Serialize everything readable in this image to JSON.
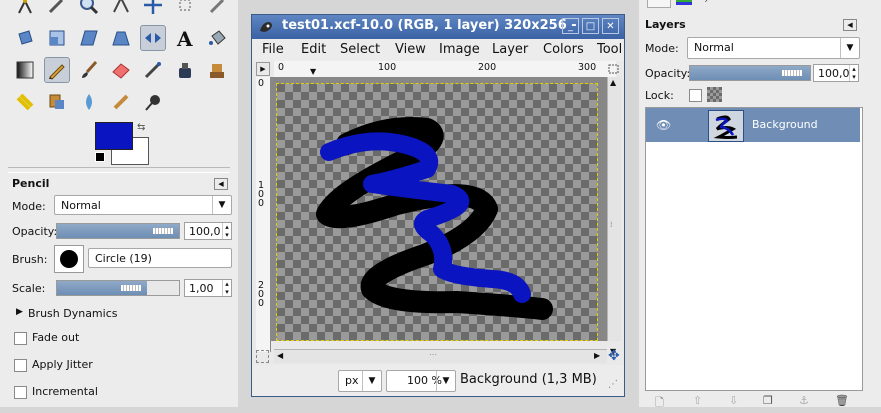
{
  "image_window": {
    "title": "test01.xcf-10.0 (RGB, 1 layer) 320x256 -",
    "menus": [
      "File",
      "Edit",
      "Select",
      "View",
      "Image",
      "Layer",
      "Colors",
      "Tool"
    ],
    "ruler_top_labels": [
      "0",
      "100",
      "200",
      "300"
    ],
    "ruler_left_labels": [
      "0",
      "1\n0\n0",
      "2\n0\n0"
    ],
    "status": {
      "unit": "px",
      "zoom": "100 %",
      "info": "Background (1,3 MB)"
    }
  },
  "toolbox": {
    "fg_color": "#0a14c0",
    "bg_color": "#ffffff",
    "tool_icons": [
      "path-icon",
      "airbrush-icon",
      "zoom-icon",
      "measure-icon",
      "move-icon",
      "align-icon",
      "crop-icon",
      "rotate-icon",
      "scale-icon",
      "shear-icon",
      "perspective-icon",
      "flip-icon",
      "text-icon",
      "bucket-fill-icon",
      "blend-icon",
      "pencil-icon",
      "paintbrush-icon",
      "eraser-icon",
      "airbrush2-icon",
      "ink-icon",
      "clone-icon",
      "heal-icon",
      "perspective-clone-icon",
      "blur-icon",
      "smudge-icon",
      "dodge-burn-icon"
    ]
  },
  "tool_options": {
    "title": "Pencil",
    "mode_label": "Mode:",
    "mode_value": "Normal",
    "opacity_label": "Opacity:",
    "opacity_value": "100,0",
    "opacity_fraction": 1.0,
    "brush_label": "Brush:",
    "brush_value": "Circle (19)",
    "scale_label": "Scale:",
    "scale_value": "1,00",
    "scale_fraction": 0.74,
    "brush_dynamics": "Brush Dynamics",
    "fade_out": "Fade out",
    "apply_jitter": "Apply Jitter",
    "incremental": "Incremental"
  },
  "layers_panel": {
    "title": "Layers",
    "mode_label": "Mode:",
    "mode_value": "Normal",
    "opacity_label": "Opacity:",
    "opacity_value": "100,0",
    "lock_label": "Lock:",
    "layers": [
      {
        "name": "Background"
      }
    ]
  }
}
